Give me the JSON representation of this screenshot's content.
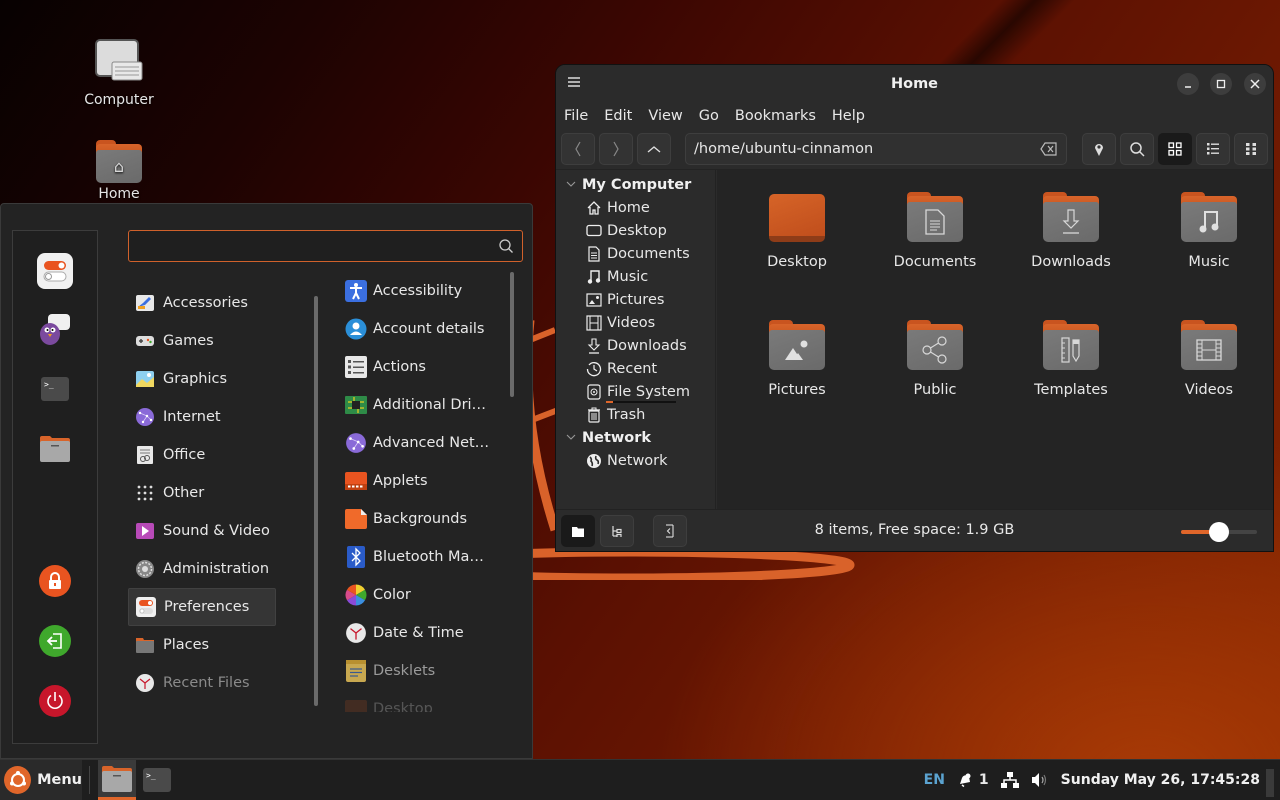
{
  "desktop": {
    "icons": [
      {
        "label": "Computer",
        "icon": "computer-icon"
      },
      {
        "label": "Home",
        "icon": "home-folder-icon"
      }
    ]
  },
  "menu": {
    "search": {
      "value": "",
      "placeholder": ""
    },
    "favorites": [
      {
        "name": "System Settings",
        "icon": "preferences-toggle-icon"
      },
      {
        "name": "Pidgin",
        "icon": "pidgin-icon"
      },
      {
        "name": "Terminal",
        "icon": "terminal-icon"
      },
      {
        "name": "Files",
        "icon": "files-icon"
      }
    ],
    "session": [
      {
        "name": "Lock Screen",
        "icon": "lock-icon",
        "color": "#e95420"
      },
      {
        "name": "Logout",
        "icon": "logout-icon",
        "color": "#3fa82c"
      },
      {
        "name": "Quit",
        "icon": "power-icon",
        "color": "#c7162b"
      }
    ],
    "categories": [
      {
        "label": "Accessories",
        "icon": "accessories-icon"
      },
      {
        "label": "Games",
        "icon": "gamepad-icon"
      },
      {
        "label": "Graphics",
        "icon": "graphics-icon"
      },
      {
        "label": "Internet",
        "icon": "internet-icon"
      },
      {
        "label": "Office",
        "icon": "office-icon"
      },
      {
        "label": "Other",
        "icon": "grid-dots-icon"
      },
      {
        "label": "Sound & Video",
        "icon": "play-icon"
      },
      {
        "label": "Administration",
        "icon": "gear-icon"
      },
      {
        "label": "Preferences",
        "icon": "preferences-toggle-icon",
        "active": true
      },
      {
        "label": "Places",
        "icon": "folder-icon"
      },
      {
        "label": "Recent Files",
        "icon": "clock-icon",
        "dim": true
      }
    ],
    "apps": [
      {
        "label": "Accessibility",
        "icon": "accessibility-icon",
        "color": "#3b6fe0"
      },
      {
        "label": "Account details",
        "icon": "account-icon",
        "color": "#2b8fd8"
      },
      {
        "label": "Actions",
        "icon": "list-icon",
        "color": "#e8e8e8"
      },
      {
        "label": "Additional Dri…",
        "icon": "chip-icon",
        "color": "#2e8b47"
      },
      {
        "label": "Advanced Net…",
        "icon": "network-globe-icon",
        "color": "#8a6ad8"
      },
      {
        "label": "Applets",
        "icon": "applets-icon",
        "color": "#e95420"
      },
      {
        "label": "Backgrounds",
        "icon": "backgrounds-icon",
        "color": "#f06a2a"
      },
      {
        "label": "Bluetooth Ma…",
        "icon": "bluetooth-icon",
        "color": "#2a5bc8"
      },
      {
        "label": "Color",
        "icon": "color-wheel-icon",
        "color": "#d84a8a"
      },
      {
        "label": "Date & Time",
        "icon": "clock-icon",
        "color": "#f0f0f0"
      },
      {
        "label": "Desklets",
        "icon": "note-icon",
        "color": "#c8a850",
        "dim": true
      },
      {
        "label": "Desktop",
        "icon": "desktop-icon",
        "color": "#a04a20",
        "fade": true
      }
    ]
  },
  "file_manager": {
    "title": "Home",
    "menubar": [
      "File",
      "Edit",
      "View",
      "Go",
      "Bookmarks",
      "Help"
    ],
    "path": "/home/ubuntu-cinnamon",
    "sidebar": {
      "sections": [
        {
          "title": "My Computer",
          "items": [
            {
              "label": "Home",
              "icon": "home-icon"
            },
            {
              "label": "Desktop",
              "icon": "desktop-icon"
            },
            {
              "label": "Documents",
              "icon": "document-icon"
            },
            {
              "label": "Music",
              "icon": "music-icon"
            },
            {
              "label": "Pictures",
              "icon": "picture-icon"
            },
            {
              "label": "Videos",
              "icon": "film-icon"
            },
            {
              "label": "Downloads",
              "icon": "download-icon"
            },
            {
              "label": "Recent",
              "icon": "recent-icon"
            },
            {
              "label": "File System",
              "icon": "drive-icon",
              "usage": 0.1
            },
            {
              "label": "Trash",
              "icon": "trash-icon"
            }
          ]
        },
        {
          "title": "Network",
          "items": [
            {
              "label": "Network",
              "icon": "globe-icon"
            }
          ]
        }
      ]
    },
    "items": [
      {
        "label": "Desktop",
        "icon": "desktop-folder-icon"
      },
      {
        "label": "Documents",
        "icon": "documents-folder-icon"
      },
      {
        "label": "Downloads",
        "icon": "downloads-folder-icon"
      },
      {
        "label": "Music",
        "icon": "music-folder-icon"
      },
      {
        "label": "Pictures",
        "icon": "pictures-folder-icon"
      },
      {
        "label": "Public",
        "icon": "public-folder-icon"
      },
      {
        "label": "Templates",
        "icon": "templates-folder-icon"
      },
      {
        "label": "Videos",
        "icon": "videos-folder-icon"
      }
    ],
    "status": "8 items, Free space: 1.9 GB",
    "zoom_level": 0.5
  },
  "panel": {
    "menu_label": "Menu",
    "keyboard_layout": "EN",
    "notifications_count": "1",
    "clock": "Sunday May 26, 17:45:28"
  },
  "colors": {
    "accent": "#e0662a",
    "panel_bg": "#1e1e1e",
    "window_bg": "#2b2b2b"
  }
}
